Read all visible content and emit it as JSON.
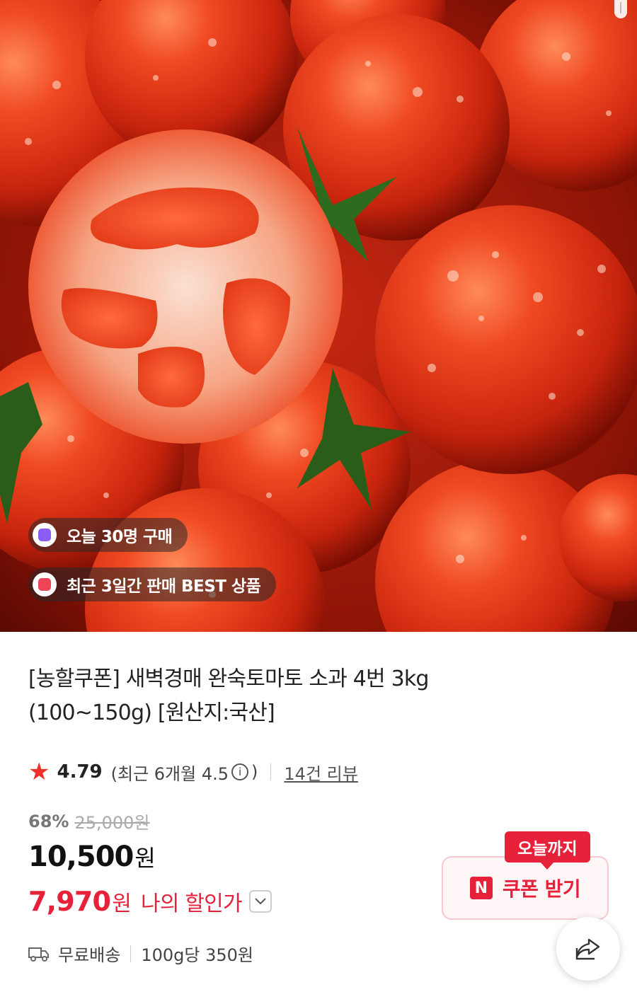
{
  "badges": {
    "today_buyers": "오늘 30명 구매",
    "best": "최근 3일간 판매 BEST 상품"
  },
  "product": {
    "title_line1": "[농할쿠폰] 새벽경매 완숙토마토 소과 4번 3kg",
    "title_line2": "(100~150g) [원산지:국산]"
  },
  "rating": {
    "score": "4.79",
    "recent_prefix": "(최근 6개월 4.5",
    "info_glyph": "i",
    "recent_suffix": ")",
    "review_count": "14건 리뷰"
  },
  "pricing": {
    "discount_pct": "68%",
    "original_price": "25,000원",
    "price": "10,500",
    "price_unit": "원",
    "my_price": "7,970",
    "my_price_unit": "원",
    "my_price_label": "나의 할인가"
  },
  "coupon": {
    "tag": "오늘까지",
    "logo": "N",
    "label": "쿠폰 받기"
  },
  "shipping": {
    "free_shipping": "무료배송",
    "unit_price": "100g당 350원"
  },
  "icons": {
    "star": "star-icon",
    "chevron": "chevron-down-icon",
    "truck": "truck-icon",
    "share": "share-icon"
  },
  "colors": {
    "accent_red": "#e8213a",
    "star_red": "#f0312a",
    "badge_purple": "#8b5cf6",
    "badge_red": "#ef4457"
  }
}
